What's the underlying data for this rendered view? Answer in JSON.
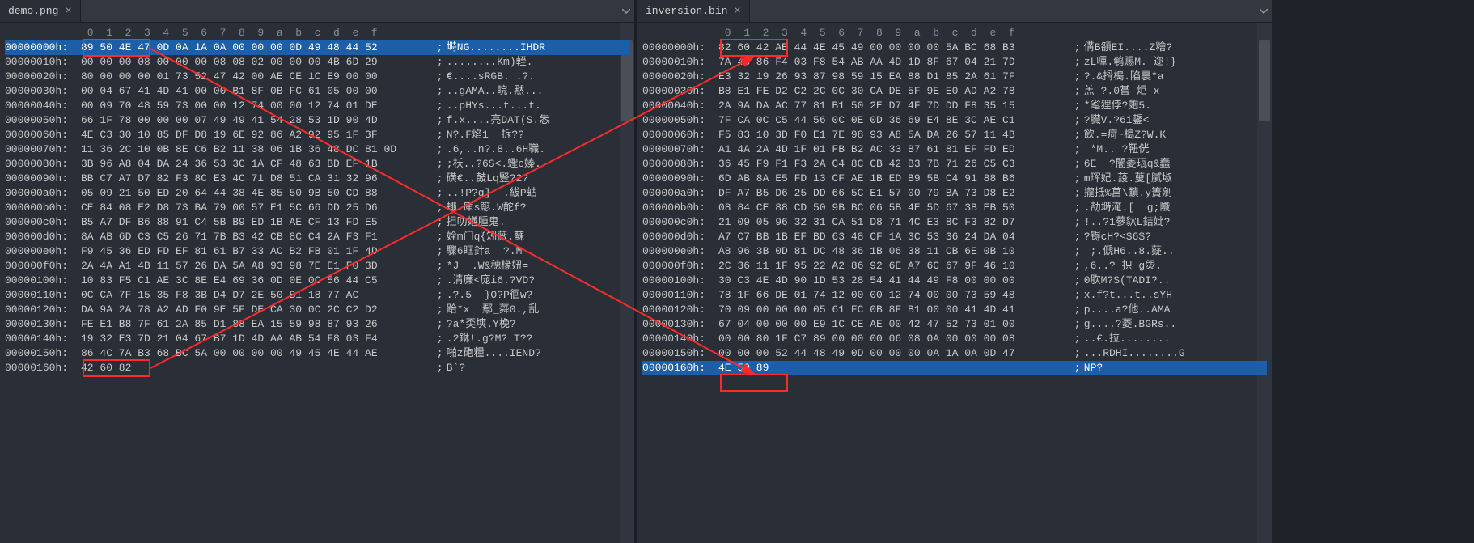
{
  "left": {
    "tab": {
      "title": "demo.png",
      "close": "×"
    },
    "colHeader": " 0  1  2  3  4  5  6  7  8  9  a  b  c  d  e  f",
    "highlightRow": 0,
    "rows": [
      {
        "addr": "00000000h:",
        "bytes": "89 50 4E 47 0D 0A 1A 0A 00 00 00 0D 49 48 44 52",
        "ascii": " 塒NG........IHDR"
      },
      {
        "addr": "00000010h:",
        "bytes": "00 00 00 08 00 00 00 08 08 02 00 00 00 4B 6D 29",
        "ascii": " ........Km)輊."
      },
      {
        "addr": "00000020h:",
        "bytes": "80 00 00 00 01 73 52 47 42 00 AE CE 1C E9 00 00",
        "ascii": " €....sRGB. .?."
      },
      {
        "addr": "00000030h:",
        "bytes": "00 04 67 41 4D 41 00 00 B1 8F 0B FC 61 05 00 00",
        "ascii": " ..gAMA..睆.黙..."
      },
      {
        "addr": "00000040h:",
        "bytes": "00 09 70 48 59 73 00 00 12 74 00 00 12 74 01 DE",
        "ascii": " ..pHYs...t...t."
      },
      {
        "addr": "00000050h:",
        "bytes": "66 1F 78 00 00 00 07 49 49 41 54 28 53 1D 90 4D",
        "ascii": " f.x....亮DAT(S.怣"
      },
      {
        "addr": "00000060h:",
        "bytes": "4E C3 30 10 85 DF D8 19 6E 92 86 A2 92 95 1F 3F",
        "ascii": " N?.F焰1  拆??"
      },
      {
        "addr": "00000070h:",
        "bytes": "11 36 2C 10 0B 8E C6 B2 11 38 06 1B 36 48 DC 81 0D",
        "ascii": " .6,..n?.8..6H職."
      },
      {
        "addr": "00000080h:",
        "bytes": "3B 96 A8 04 DA 24 36 53 3C 1A CF 48 63 BD EF 1B",
        "ascii": " ;枖..?6S<.蟶c嫀."
      },
      {
        "addr": "00000090h:",
        "bytes": "BB C7 A7 D7 82 F3 8C E3 4C 71 D8 51 CA 31 32 96",
        "ascii": " 磺€..鼓Lq豎?2?"
      },
      {
        "addr": "000000a0h:",
        "bytes": "05 09 21 50 ED 20 64 44 38 4E 85 50 9B 50 CD 88",
        "ascii": " ..!P?g]  .紱P蛄"
      },
      {
        "addr": "000000b0h:",
        "bytes": "CE 84 08 E2 D8 73 BA 79 00 57 E1 5C 66 DD 25 D6",
        "ascii": " 蠅.庫s簓.W酡f?"
      },
      {
        "addr": "000000c0h:",
        "bytes": "B5 A7 DF B6 88 91 C4 5B B9 ED 1B AE CF 13 FD E5",
        "ascii": " 担叻嫸腫鬼."
      },
      {
        "addr": "000000d0h:",
        "bytes": "8A AB 6D C3 C5 26 71 7B B3 42 CB 8C C4 2A F3 F1",
        "ascii": " 姾m门q{矧薇.蘇"
      },
      {
        "addr": "000000e0h:",
        "bytes": "F9 45 36 ED FD EF 81 61 B7 33 AC B2 FB 01 1F 4D",
        "ascii": " 驟6眶針a  ?.M"
      },
      {
        "addr": "000000f0h:",
        "bytes": "2A 4A A1 4B 11 57 26 DA 5A A8 93 98 7E E1 F0 3D",
        "ascii": " *J  .W&穂椽妞="
      },
      {
        "addr": "00000100h:",
        "bytes": "10 83 F5 C1 AE 3C 8E E4 69 36 0D 0E 0C 56 44 C5",
        "ascii": " .清廉<庞i6.?VD?"
      },
      {
        "addr": "00000110h:",
        "bytes": "0C CA 7F 15 35 F8 3B D4 D7 2E 50 B1 18 77 AC",
        "ascii": " .?.5  }O?P徊w?"
      },
      {
        "addr": "00000120h:",
        "bytes": "DA 9A 2A 78 A2 AD F0 9E 5F DE CA 30 0C 2C C2 D2",
        "ascii": " 跲*x  鄢_蕣0.,乱"
      },
      {
        "addr": "00000130h:",
        "bytes": "FE E1 B8 7F 61 2A 85 D1 88 EA 15 59 98 87 93 26",
        "ascii": " ?a*奀塽.Y梚?"
      },
      {
        "addr": "00000140h:",
        "bytes": "19 32 E3 7D 21 04 67 B7 1D 4D AA AB 54 F8 03 F4",
        "ascii": " .2銝!.g?M? T??"
      },
      {
        "addr": "00000150h:",
        "bytes": "86 4C 7A B3 68 BC 5A 00 00 00 00 49 45 4E 44 AE",
        "ascii": " 啪z砲糧....IEND?"
      },
      {
        "addr": "00000160h:",
        "bytes": "42 60 82",
        "ascii": " B`?"
      }
    ]
  },
  "right": {
    "tab": {
      "title": "inversion.bin",
      "close": "×"
    },
    "colHeader": " 0  1  2  3  4  5  6  7  8  9  a  b  c  d  e  f",
    "highlightRow": 22,
    "rows": [
      {
        "addr": "00000000h:",
        "bytes": "82 60 42 AE 44 4E 45 49 00 00 00 00 5A BC 68 B3",
        "ascii": " 傋B頟EI....Z糩?"
      },
      {
        "addr": "00000010h:",
        "bytes": "7A 4C 86 F4 03 F8 54 AB AA 4D 1D 8F 67 04 21 7D",
        "ascii": " zL喗.鹌赐M. 迩!}"
      },
      {
        "addr": "00000020h:",
        "bytes": "E3 32 19 26 93 87 98 59 15 EA 88 D1 85 2A 61 7F",
        "ascii": " ?.&搰槝.陷裏*a"
      },
      {
        "addr": "00000030h:",
        "bytes": "B8 E1 FE D2 C2 2C 0C 30 CA DE 5F 9E E0 AD A2 78",
        "ascii": " 羔 ?.0嘗_炬 x"
      },
      {
        "addr": "00000040h:",
        "bytes": "2A 9A DA AC 77 81 B1 50 2E D7 4F 7D DD F8 35 15",
        "ascii": " *毟狸侼?皰5."
      },
      {
        "addr": "00000050h:",
        "bytes": "7F CA 0C C5 44 56 0C 0E 0D 36 69 E4 8E 3C AE C1",
        "ascii": " ?臟V.?6i鋬<"
      },
      {
        "addr": "00000060h:",
        "bytes": "F5 83 10 3D F0 E1 7E 98 93 A8 5A DA 26 57 11 4B",
        "ascii": " 飲.=疴~槝Z?W.K"
      },
      {
        "addr": "00000070h:",
        "bytes": "A1 4A 2A 4D 1F 01 FB B2 AC 33 B7 61 81 EF FD ED",
        "ascii": "  *M.. ?靵侊"
      },
      {
        "addr": "00000080h:",
        "bytes": "36 45 F9 F1 F3 2A C4 8C CB 42 B3 7B 71 26 C5 C3",
        "ascii": " 6E  ?闇菱珁q&蠢"
      },
      {
        "addr": "00000090h:",
        "bytes": "6D AB 8A E5 FD 13 CF AE 1B ED B9 5B C4 91 88 B6",
        "ascii": " m珲妃.蔎.蓃[膩埱"
      },
      {
        "addr": "000000a0h:",
        "bytes": "DF A7 B5 D6 25 DD 66 5C E1 57 00 79 BA 73 D8 E2",
        "ascii": " 攏抵%莒\\靧.y簀剜"
      },
      {
        "addr": "000000b0h:",
        "bytes": "08 84 CE 88 CD 50 9B BC 06 5B 4E 5D 67 3B EB 50",
        "ascii": " .劼塒淹.[  g;隵"
      },
      {
        "addr": "000000c0h:",
        "bytes": "21 09 05 96 32 31 CA 51 D8 71 4C E3 8C F3 82 D7",
        "ascii": " !..?1蔘貁L銡妣?"
      },
      {
        "addr": "000000d0h:",
        "bytes": "A7 C7 BB 1B EF BD 63 48 CF 1A 3C 53 36 24 DA 04",
        "ascii": " ?锝cH?<S6$?"
      },
      {
        "addr": "000000e0h:",
        "bytes": "A8 96 3B 0D 81 DC 48 36 1B 06 38 11 CB 6E 0B 10",
        "ascii": "  ;.傂H6..8.薿.."
      },
      {
        "addr": "000000f0h:",
        "bytes": "2C 36 11 1F 95 22 A2 86 92 6E A7 6C 67 9F 46 10",
        "ascii": " ,6..? 抧 g焈."
      },
      {
        "addr": "00000100h:",
        "bytes": "30 C3 4E 4D 90 1D 53 28 54 41 44 49 F8 00 00 00",
        "ascii": " 0肷M?S(TADI?.."
      },
      {
        "addr": "00000110h:",
        "bytes": "78 1F 66 DE 01 74 12 00 00 12 74 00 00 73 59 48",
        "ascii": " x.f?t...t..sYH"
      },
      {
        "addr": "00000120h:",
        "bytes": "70 09 00 00 00 05 61 FC 0B 8F B1 00 00 41 4D 41",
        "ascii": " p....a?他..AMA"
      },
      {
        "addr": "00000130h:",
        "bytes": "67 04 00 00 00 E9 1C CE AE 00 42 47 52 73 01 00",
        "ascii": " g....?菱.BGRs.."
      },
      {
        "addr": "00000140h:",
        "bytes": "00 00 80 1F C7 89 00 00 00 06 08 0A 00 00 00 08",
        "ascii": " ..€.拉........"
      },
      {
        "addr": "00000150h:",
        "bytes": "00 00 00 52 44 48 49 0D 00 00 00 0A 1A 0A 0D 47",
        "ascii": " ...RDHI........G"
      },
      {
        "addr": "00000160h:",
        "bytes": "4E 50 89",
        "ascii": " NP?"
      }
    ]
  }
}
